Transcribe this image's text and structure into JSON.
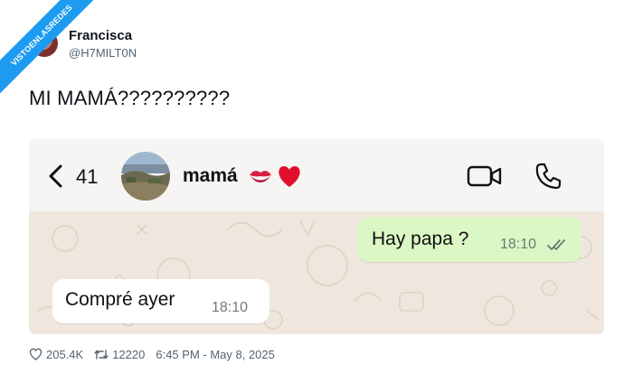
{
  "ribbon": {
    "text": "VISTOENLASREDES"
  },
  "author": {
    "name": "Francisca",
    "handle": "@H7MILT0N"
  },
  "tweet": {
    "text": "MI MAMÁ??????????"
  },
  "chat": {
    "back_count": "41",
    "contact_name": "mamá",
    "emojis": [
      "kiss-mark",
      "red-heart"
    ],
    "messages": [
      {
        "direction": "outgoing",
        "text": "Hay papa ?",
        "time": "18:10",
        "status": "read-double-check"
      },
      {
        "direction": "incoming",
        "text": "Compré ayer",
        "time": "18:10"
      }
    ]
  },
  "stats": {
    "likes": "205.4K",
    "retweets": "12220",
    "timestamp": "6:45 PM - May 8, 2025"
  },
  "colors": {
    "accent": "#1d9bf0",
    "outgoing_bubble": "#dcf7c6",
    "incoming_bubble": "#ffffff",
    "chat_bg": "#efe7dd"
  }
}
